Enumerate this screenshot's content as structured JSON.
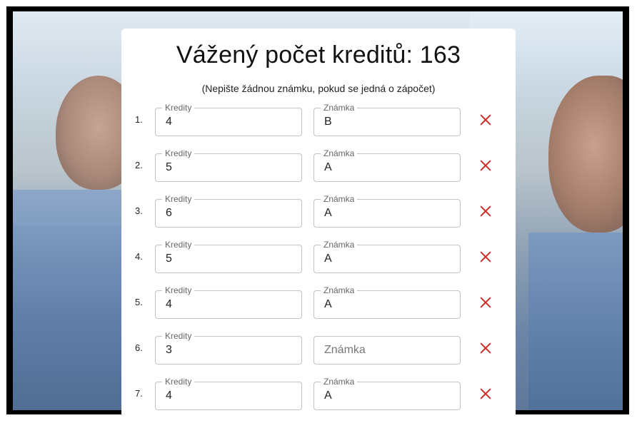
{
  "title": "Vážený počet kreditů: 163",
  "subtitle": "(Nepište žádnou známku, pokud se jedná o zápočet)",
  "labels": {
    "kredity": "Kredity",
    "znamka": "Známka"
  },
  "colors": {
    "delete": "#d32f2f",
    "border": "#c4c4c4"
  },
  "rows": [
    {
      "number": "1.",
      "kredity": "4",
      "znamka": "B"
    },
    {
      "number": "2.",
      "kredity": "5",
      "znamka": "A"
    },
    {
      "number": "3.",
      "kredity": "6",
      "znamka": "A"
    },
    {
      "number": "4.",
      "kredity": "5",
      "znamka": "A"
    },
    {
      "number": "5.",
      "kredity": "4",
      "znamka": "A"
    },
    {
      "number": "6.",
      "kredity": "3",
      "znamka": "",
      "znamka_placeholder": "Známka"
    },
    {
      "number": "7.",
      "kredity": "4",
      "znamka": "A"
    }
  ]
}
